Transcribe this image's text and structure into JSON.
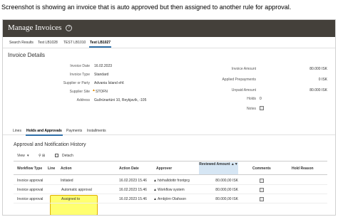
{
  "caption": "Screenshot is showing an invoice that is auto approved but then assigned to another rule for approval.",
  "app": {
    "title": "Manage Invoices",
    "help_glyph": "?"
  },
  "tabs": [
    "Search Results",
    "Test LB1028",
    "TEST LB1010",
    "Test LB1027"
  ],
  "active_tab": "Test LB1027",
  "details": {
    "title": "Invoice Details",
    "left": [
      {
        "label": "Invoice Date",
        "value": "16.02.2023"
      },
      {
        "label": "Invoice Type",
        "value": "Standard"
      },
      {
        "label": "Supplier or Party",
        "value": "Advania Ísland ehf."
      },
      {
        "label": "Supplier Site",
        "value": "STOFN"
      },
      {
        "label": "Address",
        "value": "Guðrúnartúni 10, Reykjavík, -105"
      }
    ],
    "right": [
      {
        "label": "Invoice Amount",
        "value": "80.000 ISK"
      },
      {
        "label": "Applied Prepayments",
        "value": "0 ISK"
      },
      {
        "label": "Unpaid Amount",
        "value": "80.000 ISK"
      },
      {
        "label": "Holds",
        "value": "0"
      },
      {
        "label": "Notes",
        "value": ""
      }
    ]
  },
  "subtabs": [
    "Lines",
    "Holds and Approvals",
    "Payments",
    "Installments"
  ],
  "active_subtab": "Holds and Approvals",
  "history": {
    "title": "Approval and Notification History",
    "view_label": "View",
    "detach_label": "Detach",
    "columns": [
      "Workflow Type",
      "Line",
      "Action",
      "Action Date",
      "Approver",
      "Reviewed Amount",
      "Comments",
      "Hold Reason"
    ],
    "rows": [
      {
        "type": "Invoice approval",
        "line": "",
        "action": "Initiated",
        "date": "16.02.2023 15.46",
        "approver": "hörhalldottir frontprg",
        "amount": "80.000,00 ISK"
      },
      {
        "type": "Invoice approval",
        "line": "",
        "action": "Automatic approval",
        "date": "16.02.2023 15.46",
        "approver": "Workflow system",
        "amount": "80.000,00 ISK"
      },
      {
        "type": "Invoice approval",
        "line": "",
        "action": "Assigned to",
        "date": "16.02.2023 15.46",
        "approver": "Arnbjörn Olafsson",
        "amount": "80.000,00 ISK"
      }
    ]
  },
  "colors": {
    "titlebar": "#44403a",
    "accent": "#2f6fa8",
    "highlight": "#ffff70",
    "flag": "#e08a00"
  },
  "icons": [
    "help-icon",
    "notes-icon",
    "view-dropdown-icon",
    "detach-icon",
    "sort-icon",
    "comment-icon"
  ]
}
